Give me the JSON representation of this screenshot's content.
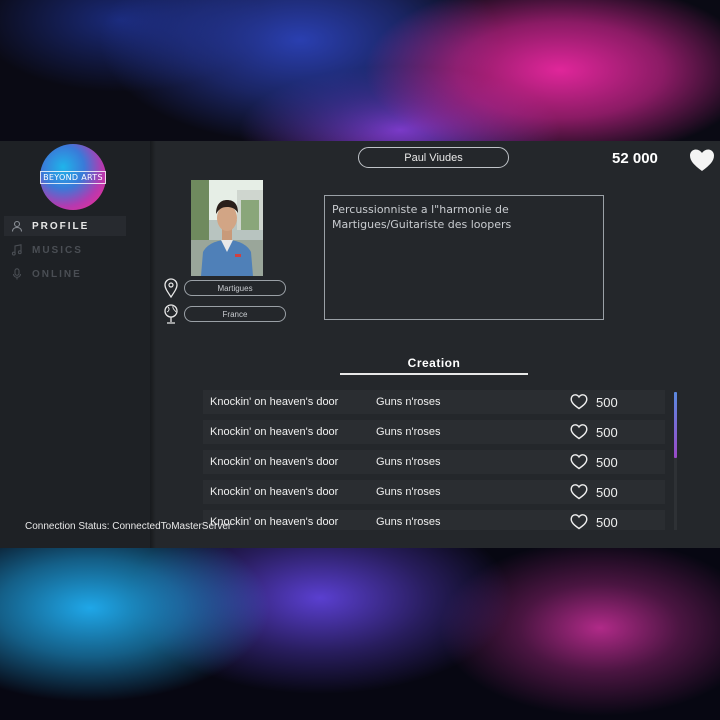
{
  "profile": {
    "name": "Paul Viudes",
    "city": "Martigues",
    "country": "France",
    "bio": "Percussionniste a l\"harmonie de Martigues/Guitariste des loopers"
  },
  "header": {
    "likes_total": "52 000"
  },
  "logo": {
    "text": "BEYOND ARTS"
  },
  "sidebar": {
    "items": [
      {
        "label": "PROFILE",
        "icon": "user-icon",
        "active": true
      },
      {
        "label": "MUSICS",
        "icon": "music-note-icon",
        "active": false
      },
      {
        "label": "ONLINE",
        "icon": "microphone-icon",
        "active": false
      }
    ]
  },
  "creation": {
    "tab_label": "Creation",
    "rows": [
      {
        "song": "Knockin' on heaven's door",
        "artist": "Guns n'roses",
        "likes": "500"
      },
      {
        "song": "Knockin' on heaven's door",
        "artist": "Guns n'roses",
        "likes": "500"
      },
      {
        "song": "Knockin' on heaven's door",
        "artist": "Guns n'roses",
        "likes": "500"
      },
      {
        "song": "Knockin' on heaven's door",
        "artist": "Guns n'roses",
        "likes": "500"
      },
      {
        "song": "Knockin' on heaven's door",
        "artist": "Guns n'roses",
        "likes": "500"
      }
    ]
  },
  "status": {
    "text": "Connection Status: ConnectedToMasterServer"
  },
  "colors": {
    "panel": "#24272b",
    "sidebar": "#1e2125",
    "row": "#2a2d31",
    "accent_pink": "#e0269a",
    "accent_blue": "#1fa7e8"
  }
}
